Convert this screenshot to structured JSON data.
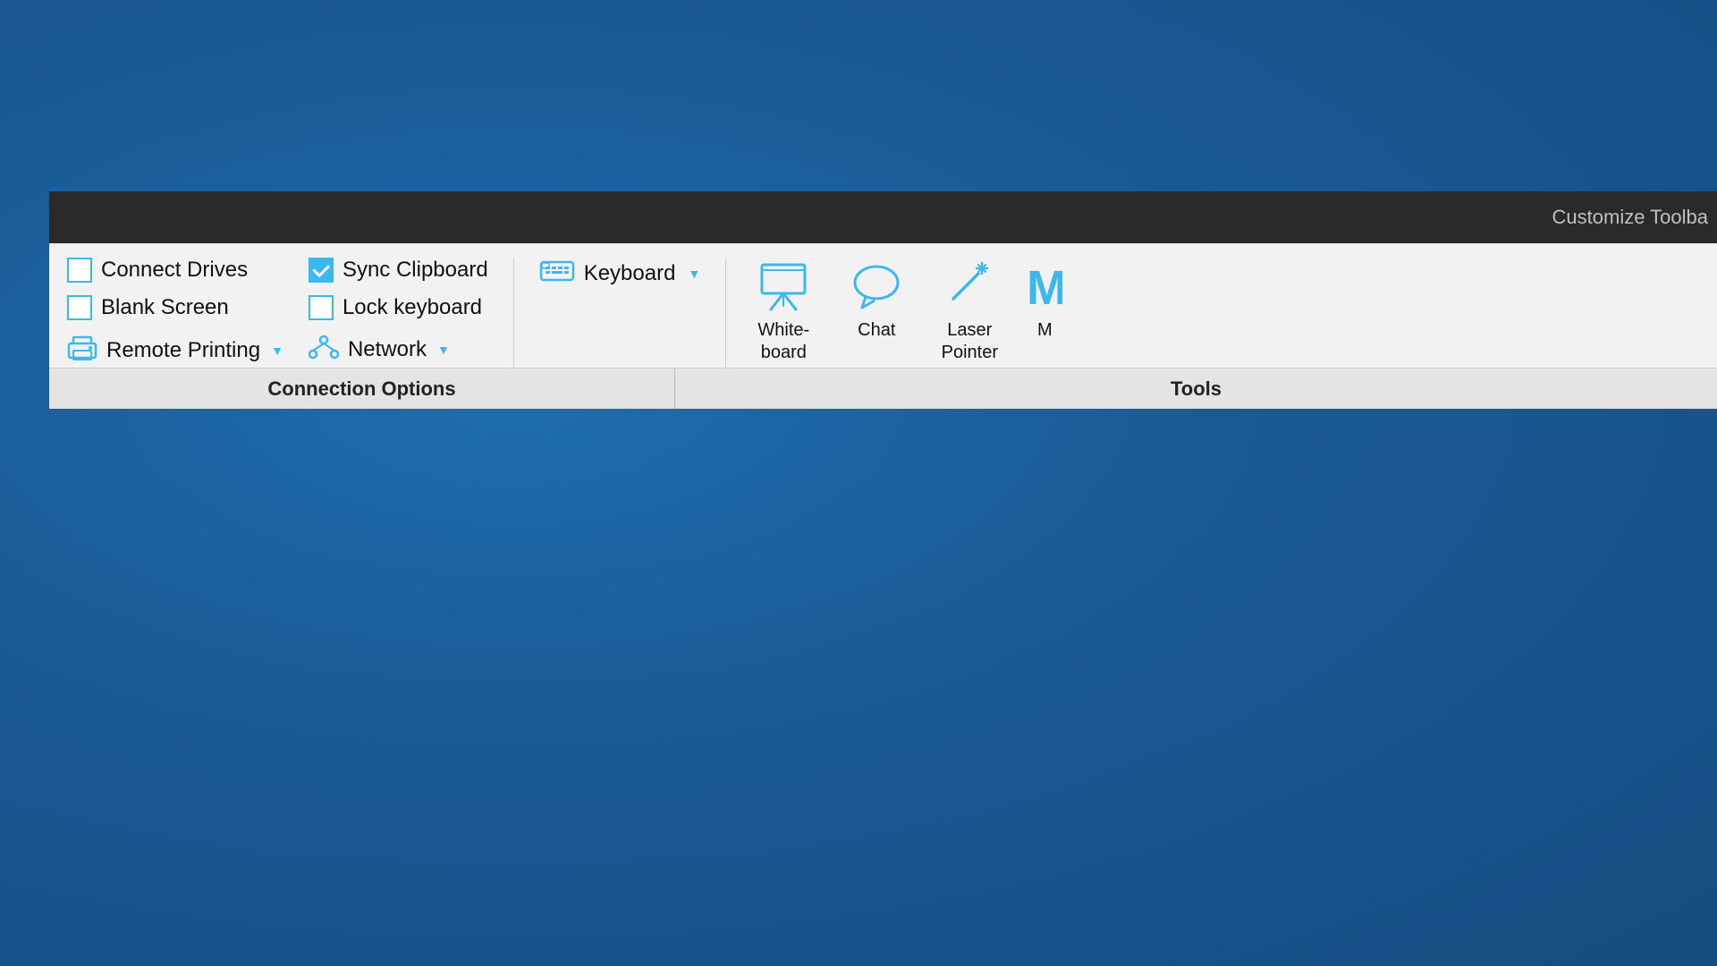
{
  "background": "#1a5b96",
  "titleBar": {
    "text": "Customize Toolba"
  },
  "connectionOptions": {
    "sectionLabel": "Connection Options",
    "items": [
      {
        "id": "connect-drives",
        "label": "Connect Drives",
        "checked": false,
        "hasIcon": false
      },
      {
        "id": "blank-screen",
        "label": "Blank Screen",
        "checked": false,
        "hasIcon": false
      },
      {
        "id": "sync-clipboard",
        "label": "Sync Clipboard",
        "checked": true,
        "hasIcon": false
      },
      {
        "id": "lock-keyboard",
        "label": "Lock keyboard",
        "checked": false,
        "hasIcon": false
      },
      {
        "id": "keyboard",
        "label": "Keyboard",
        "hasDropdown": true,
        "hasIcon": true
      },
      {
        "id": "remote-printing",
        "label": "Remote Printing",
        "hasDropdown": true,
        "hasIcon": true
      },
      {
        "id": "network",
        "label": "Network",
        "hasDropdown": true,
        "hasIcon": true
      }
    ]
  },
  "tools": {
    "sectionLabel": "Tools",
    "items": [
      {
        "id": "whiteboard",
        "label": "White-\nboard",
        "iconType": "whiteboard"
      },
      {
        "id": "chat",
        "label": "Chat",
        "iconType": "chat"
      },
      {
        "id": "laser-pointer",
        "label": "Laser\nPointer",
        "iconType": "laser"
      },
      {
        "id": "more",
        "label": "M",
        "iconType": "more",
        "partial": true
      }
    ]
  }
}
